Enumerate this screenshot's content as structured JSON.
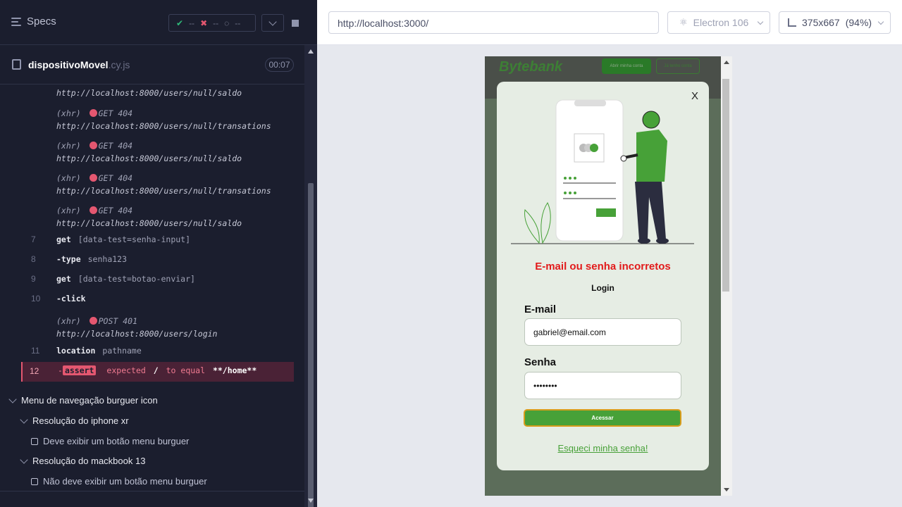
{
  "sidebar": {
    "specs_label": "Specs",
    "stats": {
      "passed": "--",
      "failed": "--",
      "pending": "--"
    },
    "spec_file": {
      "name": "dispositivoMovel",
      "ext": ".cy.js",
      "duration": "00:07"
    }
  },
  "log": [
    {
      "kind": "url",
      "text": "http://localhost:8000/users/null/saldo"
    },
    {
      "kind": "xhr",
      "label": "(xhr)",
      "method": "GET 404",
      "url": "http://localhost:8000/users/null/transations"
    },
    {
      "kind": "xhr",
      "label": "(xhr)",
      "method": "GET 404",
      "url": "http://localhost:8000/users/null/saldo"
    },
    {
      "kind": "xhr",
      "label": "(xhr)",
      "method": "GET 404",
      "url": "http://localhost:8000/users/null/transations"
    },
    {
      "kind": "xhr",
      "label": "(xhr)",
      "method": "GET 404",
      "url": "http://localhost:8000/users/null/saldo"
    },
    {
      "kind": "cmd",
      "num": "7",
      "name": "get",
      "arg": "[data-test=senha-input]"
    },
    {
      "kind": "cmd",
      "num": "8",
      "name": "-type",
      "arg": "senha123"
    },
    {
      "kind": "cmd",
      "num": "9",
      "name": "get",
      "arg": "[data-test=botao-enviar]"
    },
    {
      "kind": "cmd",
      "num": "10",
      "name": "-click",
      "arg": ""
    },
    {
      "kind": "xhr",
      "label": "(xhr)",
      "method": "POST 401",
      "url": "http://localhost:8000/users/login"
    },
    {
      "kind": "cmd",
      "num": "11",
      "name": "location",
      "arg": "pathname"
    }
  ],
  "failed_row": {
    "num": "12",
    "prefix": "-",
    "badge": "assert",
    "text": "expected",
    "value1": "/",
    "to_equal": "to equal",
    "value2": "**/home**"
  },
  "suites": [
    {
      "label": "Menu de navegação burguer icon"
    },
    {
      "label": "Resolução do iphone xr"
    },
    {
      "test": "Deve exibir um botão menu burguer"
    },
    {
      "label": "Resolução do mackbook 13"
    },
    {
      "test": "Não deve exibir um botão menu burguer"
    }
  ],
  "toolbar": {
    "url": "http://localhost:3000/",
    "browser": "Electron 106",
    "viewport": "375x667",
    "zoom": "(94%)"
  },
  "app": {
    "logo": "Bytebank",
    "header_btn1": "Abrir minha conta",
    "header_btn2": "Já tenho conta",
    "modal": {
      "close": "X",
      "error": "E-mail ou senha incorretos",
      "title": "Login",
      "email_label": "E-mail",
      "email_value": "gabriel@email.com",
      "password_label": "Senha",
      "password_value": "••••••••",
      "submit": "Acessar",
      "forgot": "Esqueci minha senha!"
    }
  },
  "colors": {
    "brand_green": "#47a138",
    "error_red": "#e21b1b",
    "fail_bg": "#4a2236",
    "panel_bg": "#1b1e2e"
  }
}
